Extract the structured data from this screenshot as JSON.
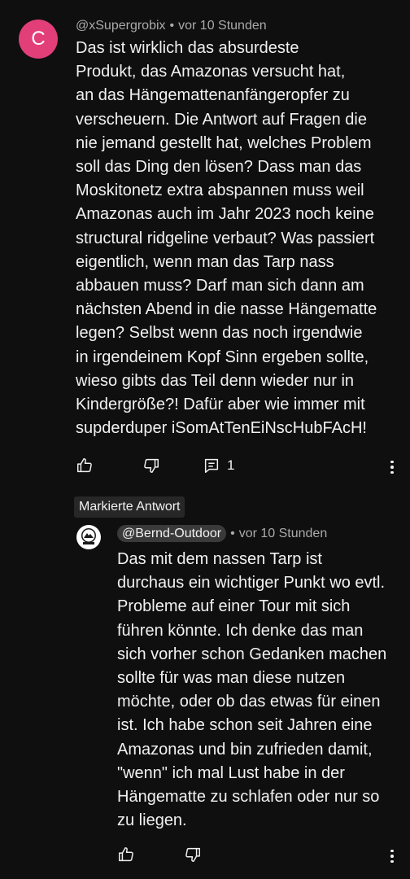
{
  "main_comment": {
    "avatar_letter": "C",
    "avatar_color": "#e23f79",
    "author": "@xSupergrobix",
    "separator": "•",
    "time": "vor 10 Stunden",
    "text": "Das ist wirklich das absurdeste\nProdukt, das Amazonas versucht hat,\nan das Hängemattenanfängeropfer zu\nverscheuern. Die Antwort auf Fragen die\nnie jemand gestellt hat, welches Problem\nsoll das Ding den lösen? Dass man das\nMoskitonetz extra abspannen muss weil\nAmazonas auch im Jahr 2023 noch keine\nstructural ridgeline verbaut? Was passiert\neigentlich, wenn man das Tarp nass\nabbauen muss? Darf man sich dann am\nnächsten Abend in die nasse Hängematte\nlegen? Selbst wenn das noch irgendwie\nin irgendeinem Kopf Sinn ergeben sollte,\nwieso gibts das Teil denn wieder nur in\nKindergröße?! Dafür aber wie immer mit\nsupderduper iSomAtTenEiNscHubFAcH!",
    "reply_count": "1",
    "icons": {
      "like": "thumbs-up-icon",
      "dislike": "thumbs-down-icon",
      "replies": "comment-icon",
      "more": "more-vertical-icon"
    }
  },
  "reply": {
    "tag": "Markierte Antwort",
    "avatar_label": "OUTDOOR",
    "author": "@Bernd-Outdoor",
    "separator": "•",
    "time": "vor 10 Stunden",
    "text": "Das mit dem nassen Tarp ist\ndurchaus ein wichtiger Punkt wo evtl.\nProbleme auf einer Tour mit sich\nführen könnte. Ich denke das man\nsich vorher schon Gedanken machen\nsollte für was man diese nutzen\nmöchte, oder ob das etwas für einen\nist. Ich habe schon seit Jahren eine\nAmazonas und bin zufrieden damit,\n\"wenn\" ich mal Lust habe in der\nHängematte zu schlafen oder nur so\nzu liegen.",
    "icons": {
      "like": "thumbs-up-icon",
      "dislike": "thumbs-down-icon",
      "more": "more-vertical-icon"
    }
  },
  "colors": {
    "background": "#0f0f0f",
    "text": "#f1f1f1",
    "meta": "#aaaaaa",
    "chip": "#272727"
  }
}
